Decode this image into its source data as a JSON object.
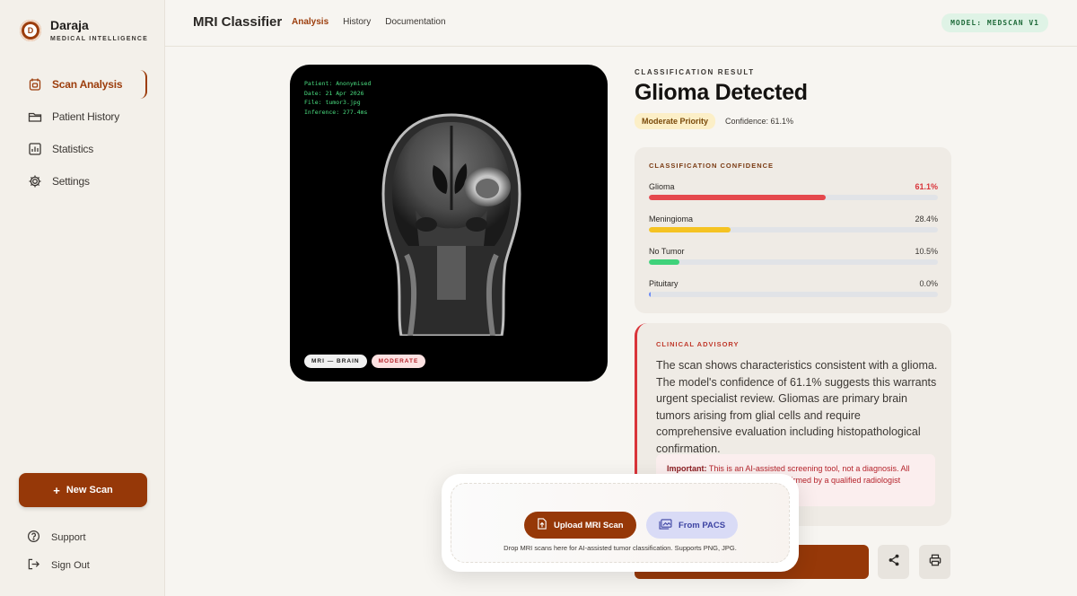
{
  "brand": {
    "name": "Daraja",
    "subtitle": "MEDICAL INTELLIGENCE",
    "logo_letter": "D"
  },
  "sidebar": {
    "items": [
      {
        "label": "Scan Analysis",
        "icon": "calendar-scan-icon",
        "active": true
      },
      {
        "label": "Patient History",
        "icon": "folder-icon",
        "active": false
      },
      {
        "label": "Statistics",
        "icon": "chart-icon",
        "active": false
      },
      {
        "label": "Settings",
        "icon": "gear-icon",
        "active": false
      }
    ],
    "new_scan": "New Scan",
    "bottom": [
      {
        "label": "Support",
        "icon": "help-icon"
      },
      {
        "label": "Sign Out",
        "icon": "sign-out-icon"
      }
    ]
  },
  "topbar": {
    "title": "MRI Classifier",
    "tabs": [
      {
        "label": "Analysis",
        "active": true
      },
      {
        "label": "History",
        "active": false
      },
      {
        "label": "Documentation",
        "active": false
      }
    ],
    "model_badge": "MODEL: MEDSCAN V1"
  },
  "scan": {
    "meta": [
      "Patient: Anonymised",
      "Date: 21 Apr 2026",
      "File: tumor3.jpg",
      "Inference: 277.4ms"
    ],
    "tags": [
      "MRI — BRAIN",
      "MODERATE"
    ]
  },
  "result": {
    "label": "CLASSIFICATION RESULT",
    "title": "Glioma Detected",
    "priority": "Moderate Priority",
    "confidence_line": "Confidence: 61.1%"
  },
  "confidence_panel": {
    "heading": "CLASSIFICATION CONFIDENCE",
    "rows": [
      {
        "label": "Glioma",
        "value": "61.1%",
        "fraction": 0.611,
        "color": "#e5484d"
      },
      {
        "label": "Meningioma",
        "value": "28.4%",
        "fraction": 0.284,
        "color": "#f5c322"
      },
      {
        "label": "No Tumor",
        "value": "10.5%",
        "fraction": 0.105,
        "color": "#3fd27a"
      },
      {
        "label": "Pituitary",
        "value": "0.0%",
        "fraction": 0.0,
        "color": "#6b8bf5"
      }
    ]
  },
  "advisory": {
    "heading": "CLINICAL ADVISORY",
    "text": "The scan shows characteristics consistent with a glioma. The model's confidence of 61.1% suggests this warrants urgent specialist review. Gliomas are primary brain tumors arising from glial cells and require comprehensive evaluation including histopathological confirmation.",
    "important_label": "Important:",
    "important_text": "This is an AI-assisted screening tool, not a diagnosis. All",
    "important_text_2": "firmed by a qualified radiologist"
  },
  "upload": {
    "upload_label": "Upload MRI Scan",
    "pacs_label": "From PACS",
    "hint": "Drop MRI scans here for AI-assisted tumor classification. Supports PNG, JPG."
  },
  "colors": {
    "accent": "#963808",
    "danger": "#d9343a",
    "scan_meta": "#4ade80"
  }
}
